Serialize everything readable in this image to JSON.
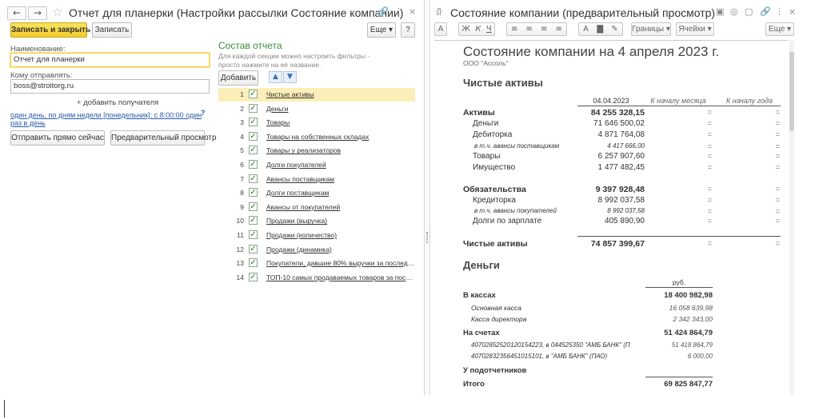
{
  "left": {
    "title": "Отчет для планерки (Настройки рассылки Состояние компании)",
    "save_close": "Записать и закрыть",
    "save": "Записать",
    "more": "Еще",
    "help": "?",
    "name_label": "Наименование:",
    "name_value": "Отчет для планерки",
    "to_label": "Кому отправлять:",
    "to_value": "boss@stroitorg.ru",
    "add_recipient": "+ добавить получателя",
    "schedule": "один день, по дням недели [понедельник]; с 8:00:00 один раз в день",
    "schedule_help": "?",
    "send_now": "Отправить прямо сейчас",
    "preview": "Предварительный просмотр",
    "composition_title": "Состав отчета",
    "composition_hint": "Для каждой секции можно настроить фильтры - просто нажмите на её название.",
    "add": "Добавить",
    "rows": [
      {
        "n": "1",
        "name": "Чистые активы",
        "checked": true
      },
      {
        "n": "2",
        "name": "Деньги",
        "checked": true
      },
      {
        "n": "3",
        "name": "Товары",
        "checked": true
      },
      {
        "n": "4",
        "name": "Товары на собственных складах",
        "checked": true
      },
      {
        "n": "5",
        "name": "Товары у реализаторов",
        "checked": true
      },
      {
        "n": "6",
        "name": "Долги покупателей",
        "checked": true
      },
      {
        "n": "7",
        "name": "Авансы поставщикам",
        "checked": true
      },
      {
        "n": "8",
        "name": "Долги поставщикам",
        "checked": true
      },
      {
        "n": "9",
        "name": "Авансы от покупателей",
        "checked": true
      },
      {
        "n": "10",
        "name": "Продажи (выручка)",
        "checked": true
      },
      {
        "n": "11",
        "name": "Продажи (количество)",
        "checked": true
      },
      {
        "n": "12",
        "name": "Продажи (динамика)",
        "checked": true
      },
      {
        "n": "13",
        "name": "Покупатели, давшие 80% выручки за последни...",
        "checked": true
      },
      {
        "n": "14",
        "name": "ТОП-10 самых продаваемых товаров за послед...",
        "checked": true
      }
    ]
  },
  "right": {
    "title": "Состояние компании (предварительный просмотр)",
    "borders": "Границы",
    "cells": "Ячейки",
    "more": "Еще",
    "report": {
      "title": "Состояние компании на 4 апреля 2023 г.",
      "company": "ООО \"Ассоль\"",
      "net_assets_header": "Чистые активы",
      "col_date": "04.04.2023",
      "col_month": "К началу месяца",
      "col_year": "К началу года",
      "assets": {
        "label": "Активы",
        "value": "84 255 328,15",
        "m": "=",
        "y": "="
      },
      "asset_rows": [
        {
          "label": "Деньги",
          "value": "71 646 500,02",
          "m": "=",
          "y": "=",
          "style": "normal"
        },
        {
          "label": "Дебиторка",
          "value": "4 871 764,08",
          "m": "=",
          "y": "=",
          "style": "normal"
        },
        {
          "label": "в т.ч. авансы поставщикам",
          "value": "4 417 666,00",
          "m": "=",
          "y": "=",
          "style": "italic"
        },
        {
          "label": "Товары",
          "value": "6 257 907,60",
          "m": "=",
          "y": "=",
          "style": "normal"
        },
        {
          "label": "Имущество",
          "value": "1 477 482,45",
          "m": "=",
          "y": "=",
          "style": "normal"
        }
      ],
      "liabilities": {
        "label": "Обязательства",
        "value": "9 397 928,48",
        "m": "=",
        "y": "="
      },
      "liability_rows": [
        {
          "label": "Кредиторка",
          "value": "8 992 037,58",
          "m": "=",
          "y": "=",
          "style": "normal"
        },
        {
          "label": "в т.ч. авансы покупателей",
          "value": "8 992 037,58",
          "m": "=",
          "y": "=",
          "style": "italic"
        },
        {
          "label": "Долги по зарплате",
          "value": "405 890,90",
          "m": "=",
          "y": "=",
          "style": "normal"
        }
      ],
      "net": {
        "label": "Чистые активы",
        "value": "74 857 399,67",
        "m": "=",
        "y": "="
      },
      "money_header": "Деньги",
      "currency": "руб.",
      "cash": {
        "label": "В кассах",
        "value": "18 400 982,98"
      },
      "cash_rows": [
        {
          "label": "Основная касса",
          "value": "16 058 639,98"
        },
        {
          "label": "Касса директора",
          "value": "2 342 343,00"
        }
      ],
      "accounts": {
        "label": "На счетах",
        "value": "51 424 864,79"
      },
      "account_rows": [
        {
          "label": "40702852520120154223, в 044525350 \"АМБ БАНК\" (П",
          "value": "51 418 864,79"
        },
        {
          "label": "40702832356451015101, в \"АМБ БАНК\" (ПАО)",
          "value": "6 000,00"
        }
      ],
      "accountable": {
        "label": "У подотчетников",
        "value": ""
      },
      "total": {
        "label": "Итого",
        "value": "69 825 847,77"
      }
    }
  }
}
